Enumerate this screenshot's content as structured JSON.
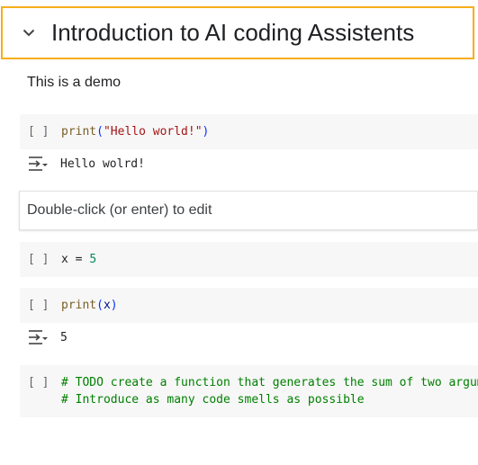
{
  "heading": {
    "title": "Introduction to AI coding Assistents",
    "collapse_icon": "chevron-down-icon"
  },
  "text_cell": {
    "text": "This is a demo"
  },
  "cells": {
    "c1": {
      "bracket": "[ ]",
      "fn": "print",
      "open": "(",
      "str": "\"Hello world!\"",
      "close": ")",
      "output": "Hello wolrd!"
    },
    "md": {
      "placeholder": "Double-click (or enter) to edit"
    },
    "c2": {
      "bracket": "[ ]",
      "var": "x",
      "op": " = ",
      "num": "5"
    },
    "c3": {
      "bracket": "[ ]",
      "fn": "print",
      "open": "(",
      "var": "x",
      "close": ")",
      "output": "5"
    },
    "c4": {
      "bracket": "[ ]",
      "line1": "# TODO create a function that generates the sum of two argum",
      "line2": "# Introduce as many code smells as possible"
    }
  },
  "colors": {
    "focus_border": "#f6ae1c",
    "cell_background": "#f7f7f7",
    "comment": "#008000",
    "string": "#a31515",
    "function": "#795e26"
  }
}
